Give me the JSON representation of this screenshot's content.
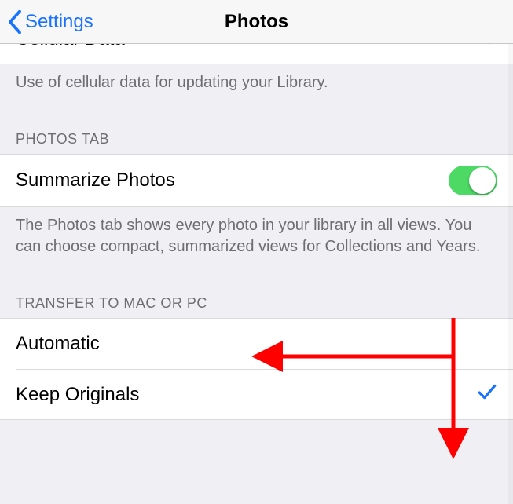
{
  "nav": {
    "back_label": "Settings",
    "title": "Photos"
  },
  "cellular": {
    "row_label": "Cellular Data",
    "footer": "Use of cellular data for updating your Library."
  },
  "photos_tab": {
    "header": "PHOTOS TAB",
    "summarize_label": "Summarize Photos",
    "summarize_on": true,
    "footer": "The Photos tab shows every photo in your library in all views. You can choose compact, summarized views for Collections and Years."
  },
  "transfer": {
    "header": "TRANSFER TO MAC OR PC",
    "options": [
      {
        "label": "Automatic",
        "selected": false
      },
      {
        "label": "Keep Originals",
        "selected": true
      }
    ]
  }
}
